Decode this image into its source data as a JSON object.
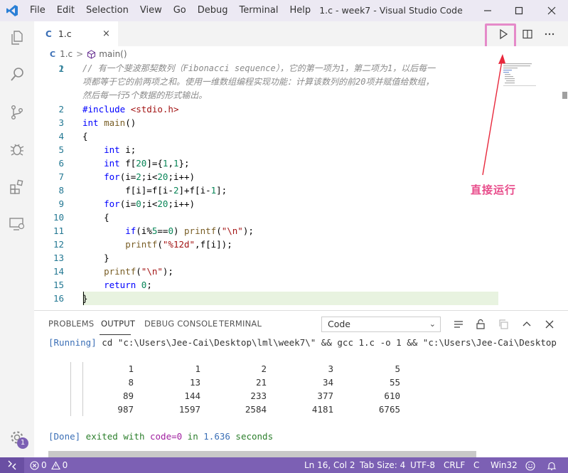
{
  "window": {
    "title": "1.c - week7 - Visual Studio Code",
    "menu": [
      "File",
      "Edit",
      "Selection",
      "View",
      "Go",
      "Debug",
      "Terminal",
      "Help"
    ]
  },
  "tab": {
    "lang_badge": "C",
    "name": "1.c",
    "close": "×"
  },
  "breadcrumb": {
    "lang_badge": "C",
    "file": "1.c",
    "sep": ">",
    "symbol": "main()"
  },
  "editor": {
    "line_numbers": [
      "1",
      "",
      "",
      "2",
      "3",
      "4",
      "5",
      "6",
      "7",
      "8",
      "9",
      "10",
      "11",
      "12",
      "13",
      "14",
      "15",
      "16"
    ],
    "comment_lines": [
      "// 有一个斐波那契数列（Fibonacci sequence），它的第一项为1，第二项为1，以后每一",
      "项都等于它的前两项之和。使用一维数组编程实现功能：计算该数列的前20项并赋值给数组，",
      "然后每一行5个数据的形式输出。"
    ],
    "code": {
      "l2_a": "#include ",
      "l2_b": "<stdio.h>",
      "l3_a": "int ",
      "l3_b": "main",
      "l3_c": "()",
      "l4": "{",
      "l5_a": "    int ",
      "l5_b": "i;",
      "l6_a": "    int ",
      "l6_b": "f[",
      "l6_c": "20",
      "l6_d": "]={",
      "l6_e": "1",
      "l6_f": ",",
      "l6_g": "1",
      "l6_h": "};",
      "l7_a": "    for",
      "l7_b": "(i=",
      "l7_c": "2",
      "l7_d": ";i<",
      "l7_e": "20",
      "l7_f": ";i++)",
      "l8_a": "        f[i]=f[i-",
      "l8_b": "2",
      "l8_c": "]+f[i-",
      "l8_d": "1",
      "l8_e": "];",
      "l9_a": "    for",
      "l9_b": "(i=",
      "l9_c": "0",
      "l9_d": ";i<",
      "l9_e": "20",
      "l9_f": ";i++)",
      "l10": "    {",
      "l11_a": "        if",
      "l11_b": "(i%",
      "l11_c": "5",
      "l11_d": "==",
      "l11_e": "0",
      "l11_f": ") ",
      "l11_g": "printf",
      "l11_h": "(",
      "l11_i": "\"\\n\"",
      "l11_j": ");",
      "l12_a": "        printf",
      "l12_b": "(",
      "l12_c": "\"%12d\"",
      "l12_d": ",f[i]);",
      "l13": "    }",
      "l14_a": "    printf",
      "l14_b": "(",
      "l14_c": "\"\\n\"",
      "l14_d": ");",
      "l15_a": "    return ",
      "l15_b": "0",
      "l15_c": ";",
      "l16": "}"
    }
  },
  "panel": {
    "tabs": [
      "PROBLEMS",
      "OUTPUT",
      "DEBUG CONSOLE",
      "TERMINAL"
    ],
    "active_tab": "OUTPUT",
    "channel_select": "Code",
    "running_tag": "[Running]",
    "running_cmd": " cd \"c:\\Users\\Jee-Cai\\Desktop\\lml\\week7\\\" && gcc 1.c -o 1 && \"c:\\Users\\Jee-Cai\\Desktop",
    "table": [
      [
        "1",
        "1",
        "2",
        "3",
        "5"
      ],
      [
        "8",
        "13",
        "21",
        "34",
        "55"
      ],
      [
        "89",
        "144",
        "233",
        "377",
        "610"
      ],
      [
        "987",
        "1597",
        "2584",
        "4181",
        "6765"
      ]
    ],
    "done_tag": "[Done]",
    "done_text1": " exited with ",
    "done_code": "code=0",
    "done_text2": " in ",
    "done_time": "1.636",
    "done_text3": " seconds"
  },
  "statusbar": {
    "errors": "0",
    "warnings": "0",
    "position": "Ln 16, Col 2",
    "tab_size": "Tab Size: 4",
    "encoding": "UTF-8",
    "eol": "CRLF",
    "language": "C",
    "platform": "Win32"
  },
  "settings_badge": "1",
  "annotation": "直接运行",
  "colors": {
    "accent": "#7c60b4",
    "highlight": "#e58ac9",
    "annotation": "#e84b8a"
  }
}
